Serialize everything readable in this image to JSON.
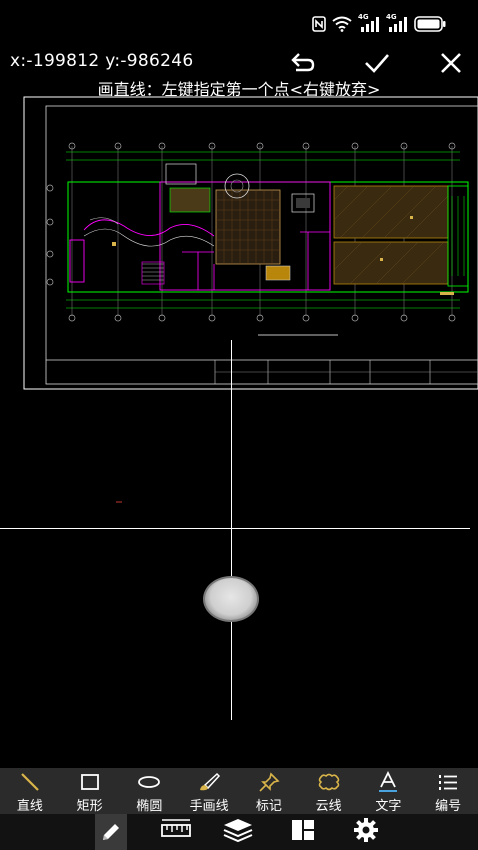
{
  "status": {
    "network_badge_1": "4G",
    "network_badge_2": "4G"
  },
  "header": {
    "coords": "x:-199812 y:-986246",
    "prompt": "画直线：左键指定第一个点<右键放弃>"
  },
  "tools": [
    {
      "label": "直线",
      "icon": "line-icon"
    },
    {
      "label": "矩形",
      "icon": "rectangle-icon"
    },
    {
      "label": "椭圆",
      "icon": "ellipse-icon"
    },
    {
      "label": "手画线",
      "icon": "brush-icon"
    },
    {
      "label": "标记",
      "icon": "pin-icon"
    },
    {
      "label": "云线",
      "icon": "cloud-line-icon"
    },
    {
      "label": "文字",
      "icon": "text-icon"
    },
    {
      "label": "编号",
      "icon": "numbered-list-icon"
    }
  ],
  "colors": {
    "line_accent": "#d8b44a",
    "toolbar_bg": "#2b2b2b",
    "cad_green": "#00ff00",
    "cad_magenta": "#ff00ff",
    "cad_brown": "#b8860b"
  }
}
